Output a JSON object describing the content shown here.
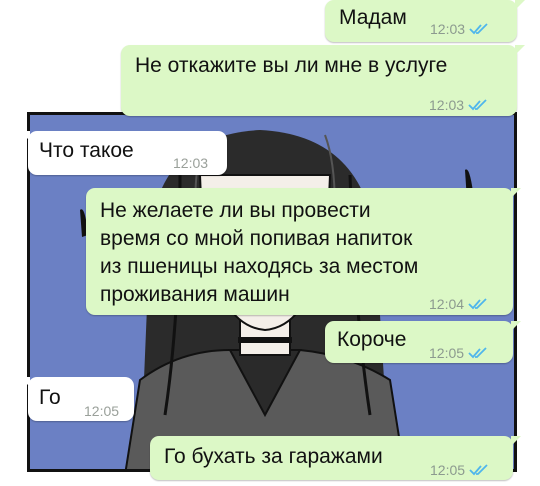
{
  "colors": {
    "outgoing_bubble": "#dcf8c6",
    "incoming_bubble": "#ffffff",
    "read_ticks": "#4fb6ec",
    "panel_background": "#6b80c4"
  },
  "messages": [
    {
      "direction": "out",
      "text": "Мадам",
      "time": "12:03",
      "status_icon": "double-check-icon"
    },
    {
      "direction": "out",
      "text": "Не откажите вы ли мне в услуге",
      "time": "12:03",
      "status_icon": "double-check-icon"
    },
    {
      "direction": "in",
      "text": "Что такое",
      "time": "12:03"
    },
    {
      "direction": "out",
      "text": "Не желаете ли вы провести\nвремя со мной попивая напиток\nиз пшеницы находясь за местом\nпроживания машин",
      "time": "12:04",
      "status_icon": "double-check-icon"
    },
    {
      "direction": "out",
      "text": "Короче",
      "time": "12:05",
      "status_icon": "double-check-icon"
    },
    {
      "direction": "in",
      "text": "Го",
      "time": "12:05"
    },
    {
      "direction": "out",
      "text": "Го бухать за гаражами",
      "time": "12:05",
      "status_icon": "double-check-icon"
    }
  ]
}
